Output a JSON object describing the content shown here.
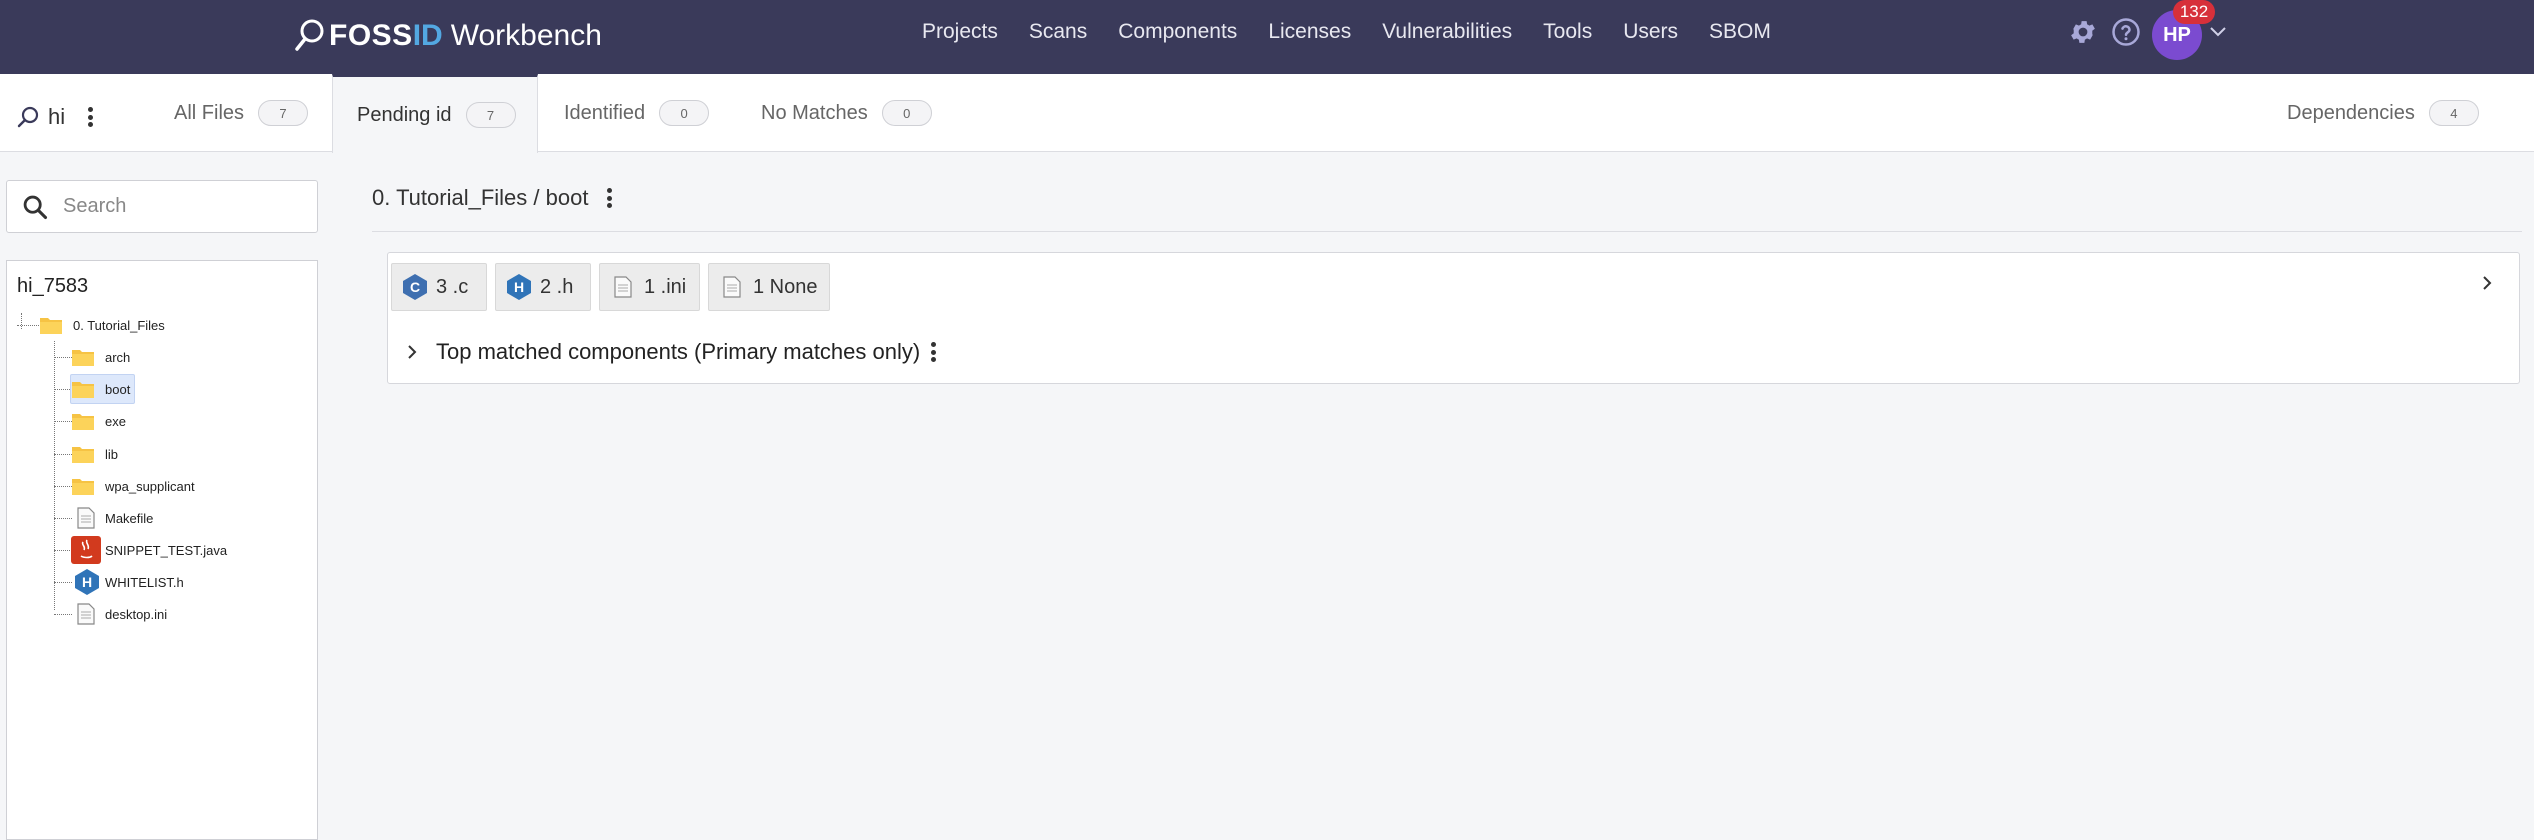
{
  "app": {
    "logo_fos": "FOSS",
    "logo_id": "ID",
    "logo_workbench": "Workbench"
  },
  "nav": [
    "Projects",
    "Scans",
    "Components",
    "Licenses",
    "Vulnerabilities",
    "Tools",
    "Users",
    "SBOM"
  ],
  "user": {
    "initials": "HP",
    "notifications": "132"
  },
  "scan": {
    "name": "hi"
  },
  "tabs": [
    {
      "label": "All Files",
      "count": "7"
    },
    {
      "label": "Pending id",
      "count": "7"
    },
    {
      "label": "Identified",
      "count": "0"
    },
    {
      "label": "No Matches",
      "count": "0"
    },
    {
      "label": "Dependencies",
      "count": "4"
    }
  ],
  "search": {
    "placeholder": "Search"
  },
  "tree": {
    "root": "hi_7583",
    "top_folder": "0. Tutorial_Files",
    "items": [
      "arch",
      "boot",
      "exe",
      "lib",
      "wpa_supplicant",
      "Makefile",
      "SNIPPET_TEST.java",
      "WHITELIST.h",
      "desktop.ini"
    ]
  },
  "breadcrumb": "0. Tutorial_Files / boot",
  "extensions": [
    {
      "text": "3 .c",
      "icon": "c-file-icon"
    },
    {
      "text": "2 .h",
      "icon": "h-file-icon"
    },
    {
      "text": "1 .ini",
      "icon": "generic-file-icon"
    },
    {
      "text": "1 None",
      "icon": "generic-file-icon"
    }
  ],
  "top_matched": "Top matched components (Primary matches only)",
  "colors": {
    "topbar": "#3a3a5a",
    "accent": "#53a8e2",
    "avatar": "#7b4bd0",
    "notification": "#d7303a",
    "selected": "#dde8fb"
  }
}
